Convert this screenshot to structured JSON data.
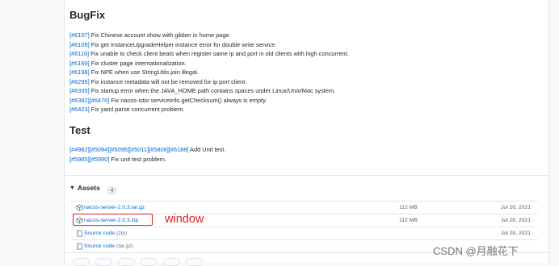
{
  "bugfix": {
    "title": "BugFix",
    "items": [
      {
        "refs": "[#6107]",
        "text": " Fix Chinese account show with gibber in home page."
      },
      {
        "refs": "[#6109]",
        "text": " Fix get InstanceUpgradeHelper instance error for double write service."
      },
      {
        "refs": "[#6116]",
        "text": " Fix unable to check client beats when register same ip and port in old clients with high concurrent."
      },
      {
        "refs": "[#6169]",
        "text": " Fix cluster page internationalization."
      },
      {
        "refs": "[#6198]",
        "text": " Fix NPE when use StringUtils.join illegal."
      },
      {
        "refs": "[#6295]",
        "text": " Fix instance metadata will not be removed for ip port client."
      },
      {
        "refs": "[#6335]",
        "text": " Fix startup error when the JAVA_HOME path contains spaces under Linux/Unix/Mac system."
      },
      {
        "refs": "[#6382][#6476]",
        "text": " Fix nacos-istio serviceInfo.getChecksum() always is empty."
      },
      {
        "refs": "[#6423]",
        "text": " Fix yaml parse concurrent problem."
      }
    ]
  },
  "test": {
    "title": "Test",
    "items": [
      {
        "refs": "[#4982][#5094][#5095][#5011][#5806][#6188]",
        "text": " Add Unit test."
      },
      {
        "refs": "[#5985][#5990]",
        "text": " Fix unit test problem."
      }
    ]
  },
  "assets": {
    "label": "Assets",
    "count": "4",
    "rows": [
      {
        "name": "nacos-server-2.0.3.tar.gz",
        "suffix": "",
        "size": "112 MB",
        "date": "Jul 28, 2021"
      },
      {
        "name": "nacos-server-2.0.3.zip",
        "suffix": "",
        "size": "112 MB",
        "date": "Jul 28, 2021"
      },
      {
        "name": "Source code",
        "suffix": " (zip)",
        "size": "",
        "date": "Jul 28, 2021"
      },
      {
        "name": "Source code",
        "suffix": " (tar.gz)",
        "size": "",
        "date": "Jul 28, 2021"
      }
    ]
  },
  "annotation": {
    "text": "window",
    "color": "#e31b1b"
  },
  "watermark": "CSDN @月融花下",
  "colors": {
    "link": "#0366d6",
    "text": "#24292e",
    "muted": "#586069"
  }
}
